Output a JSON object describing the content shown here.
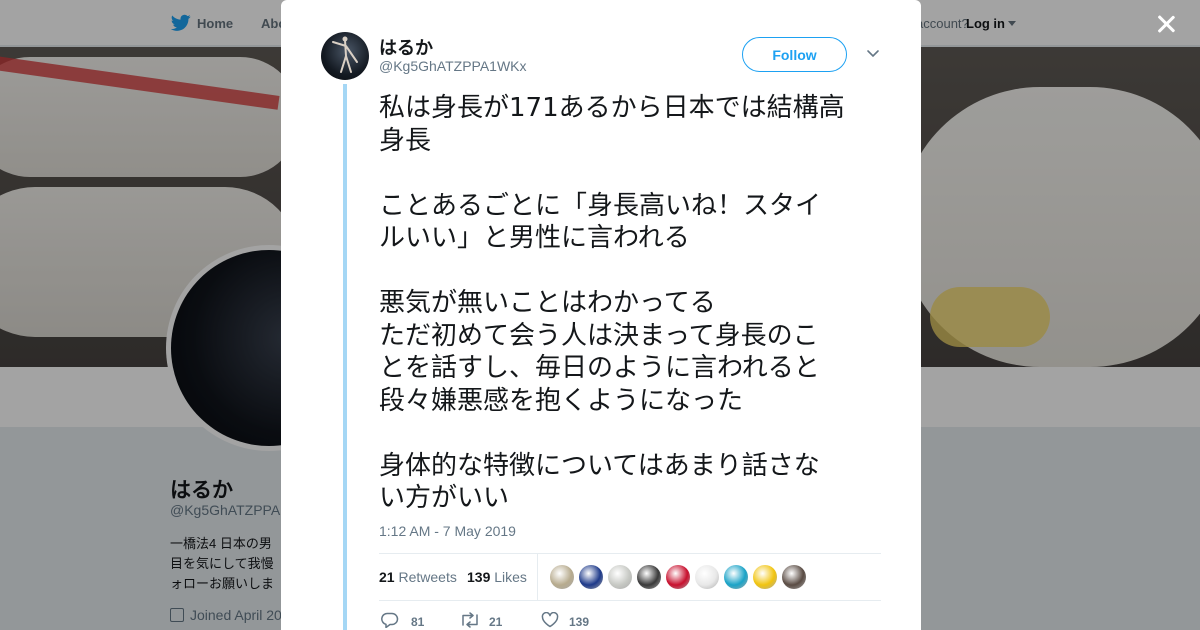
{
  "background_page": {
    "nav": {
      "home": "Home",
      "about": "Abo",
      "account": "account?",
      "login": "Log in"
    },
    "profile": {
      "name": "はるか",
      "handle": "@Kg5GhATZPPA",
      "bio_lines": [
        "一橋法4 日本の男",
        "目を気にして我慢",
        "ォローお願いしま"
      ],
      "joined": "Joined April 20"
    }
  },
  "tweet": {
    "author_name": "はるか",
    "author_handle": "@Kg5GhATZPPA1WKx",
    "follow_label": "Follow",
    "text_lines": [
      "私は身長が171あるから日本では結構高",
      "身長",
      "",
      "ことあるごとに「身長高いね！スタイ",
      "ルいい」と男性に言われる",
      "",
      "悪気が無いことはわかってる",
      "ただ初めて会う人は決まって身長のこ",
      "とを話すし、毎日のように言われると",
      "段々嫌悪感を抱くようになった",
      "",
      "身体的な特徴についてはあまり話さな",
      "い方がいい"
    ],
    "timestamp": "1:12 AM - 7 May 2019",
    "retweets": {
      "count": "21",
      "label": "Retweets"
    },
    "likes": {
      "count": "139",
      "label": "Likes"
    },
    "actions": {
      "replies": "81",
      "retweets": "21",
      "likes": "139"
    },
    "likers": [
      {
        "icon": "liker-avatar-1",
        "color": "#b7ab8e"
      },
      {
        "icon": "liker-avatar-2",
        "color": "#1e3a8a"
      },
      {
        "icon": "liker-avatar-3",
        "color": "#c7c9c4"
      },
      {
        "icon": "liker-avatar-4",
        "color": "#3a3a3a"
      },
      {
        "icon": "liker-avatar-5",
        "color": "#c8102e"
      },
      {
        "icon": "liker-avatar-6",
        "color": "#e8e8e8"
      },
      {
        "icon": "liker-avatar-7",
        "color": "#1aa3c7"
      },
      {
        "icon": "liker-avatar-8",
        "color": "#f1c40f"
      },
      {
        "icon": "liker-avatar-9",
        "color": "#5a4c44"
      }
    ]
  },
  "colors": {
    "accent": "#1da1f2",
    "thread_line": "#a5d7f5",
    "text": "#14171a",
    "muted": "#657786"
  }
}
